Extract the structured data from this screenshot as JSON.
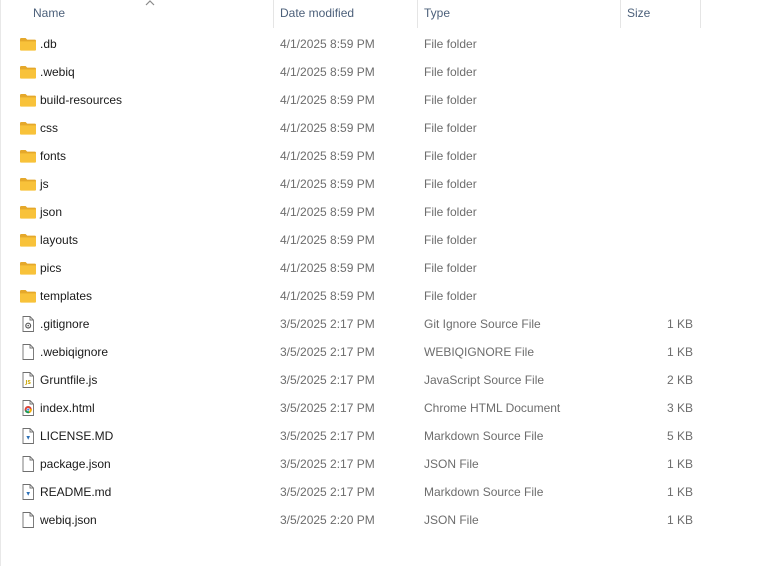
{
  "columns": {
    "name": "Name",
    "date_modified": "Date modified",
    "type": "Type",
    "size": "Size"
  },
  "sort": {
    "column": "name",
    "direction": "ascending",
    "icon": "sort-up-caret-icon"
  },
  "colors": {
    "header_text": "#4c607a",
    "folder_yellow": "#f8c23a",
    "folder_dark": "#e5a82b",
    "secondary_text": "#6d6d6d"
  },
  "files": [
    {
      "name": ".db",
      "date": "4/1/2025 8:59 PM",
      "type": "File folder",
      "size": "",
      "icon": "folder-icon"
    },
    {
      "name": ".webiq",
      "date": "4/1/2025 8:59 PM",
      "type": "File folder",
      "size": "",
      "icon": "folder-icon"
    },
    {
      "name": "build-resources",
      "date": "4/1/2025 8:59 PM",
      "type": "File folder",
      "size": "",
      "icon": "folder-icon"
    },
    {
      "name": "css",
      "date": "4/1/2025 8:59 PM",
      "type": "File folder",
      "size": "",
      "icon": "folder-icon"
    },
    {
      "name": "fonts",
      "date": "4/1/2025 8:59 PM",
      "type": "File folder",
      "size": "",
      "icon": "folder-icon"
    },
    {
      "name": "js",
      "date": "4/1/2025 8:59 PM",
      "type": "File folder",
      "size": "",
      "icon": "folder-icon"
    },
    {
      "name": "json",
      "date": "4/1/2025 8:59 PM",
      "type": "File folder",
      "size": "",
      "icon": "folder-icon"
    },
    {
      "name": "layouts",
      "date": "4/1/2025 8:59 PM",
      "type": "File folder",
      "size": "",
      "icon": "folder-icon"
    },
    {
      "name": "pics",
      "date": "4/1/2025 8:59 PM",
      "type": "File folder",
      "size": "",
      "icon": "folder-icon"
    },
    {
      "name": "templates",
      "date": "4/1/2025 8:59 PM",
      "type": "File folder",
      "size": "",
      "icon": "folder-icon"
    },
    {
      "name": ".gitignore",
      "date": "3/5/2025 2:17 PM",
      "type": "Git Ignore Source File",
      "size": "1 KB",
      "icon": "gear-file-icon"
    },
    {
      "name": ".webiqignore",
      "date": "3/5/2025 2:17 PM",
      "type": "WEBIQIGNORE File",
      "size": "1 KB",
      "icon": "blank-file-icon"
    },
    {
      "name": "Gruntfile.js",
      "date": "3/5/2025 2:17 PM",
      "type": "JavaScript Source File",
      "size": "2 KB",
      "icon": "js-file-icon"
    },
    {
      "name": "index.html",
      "date": "3/5/2025 2:17 PM",
      "type": "Chrome HTML Document",
      "size": "3 KB",
      "icon": "chrome-file-icon"
    },
    {
      "name": "LICENSE.MD",
      "date": "3/5/2025 2:17 PM",
      "type": "Markdown Source File",
      "size": "5 KB",
      "icon": "markdown-file-icon"
    },
    {
      "name": "package.json",
      "date": "3/5/2025 2:17 PM",
      "type": "JSON File",
      "size": "1 KB",
      "icon": "blank-file-icon"
    },
    {
      "name": "README.md",
      "date": "3/5/2025 2:17 PM",
      "type": "Markdown Source File",
      "size": "1 KB",
      "icon": "markdown-file-icon"
    },
    {
      "name": "webiq.json",
      "date": "3/5/2025 2:20 PM",
      "type": "JSON File",
      "size": "1 KB",
      "icon": "blank-file-icon"
    }
  ]
}
